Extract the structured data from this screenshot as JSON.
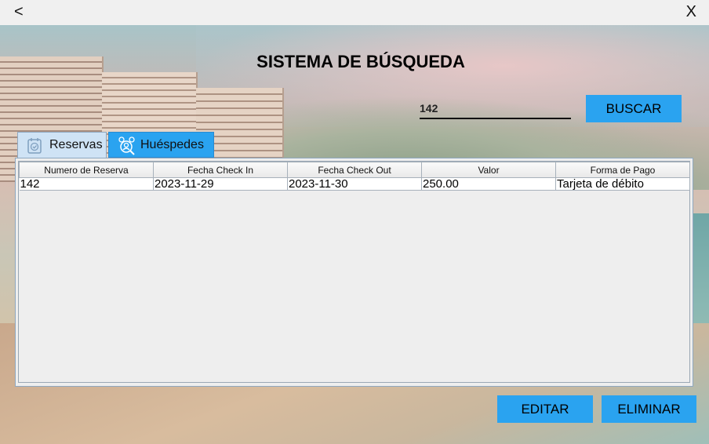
{
  "window": {
    "back_label": "<",
    "close_label": "X"
  },
  "page": {
    "title": "SISTEMA DE BÚSQUEDA"
  },
  "search": {
    "value": "142",
    "button_label": "BUSCAR"
  },
  "tabs": [
    {
      "label": "Reservas",
      "icon": "calendar-check-icon",
      "selected": true
    },
    {
      "label": "Huéspedes",
      "icon": "guests-search-icon",
      "selected": false
    }
  ],
  "table": {
    "columns": [
      "Numero de Reserva",
      "Fecha Check In",
      "Fecha Check Out",
      "Valor",
      "Forma de Pago"
    ],
    "rows": [
      [
        "142",
        "2023-11-29",
        "2023-11-30",
        "250.00",
        "Tarjeta de débito"
      ]
    ]
  },
  "actions": {
    "edit_label": "EDITAR",
    "delete_label": "ELIMINAR"
  },
  "colors": {
    "accent": "#2aa3f0",
    "tab_selected": "#cfe3f5"
  }
}
